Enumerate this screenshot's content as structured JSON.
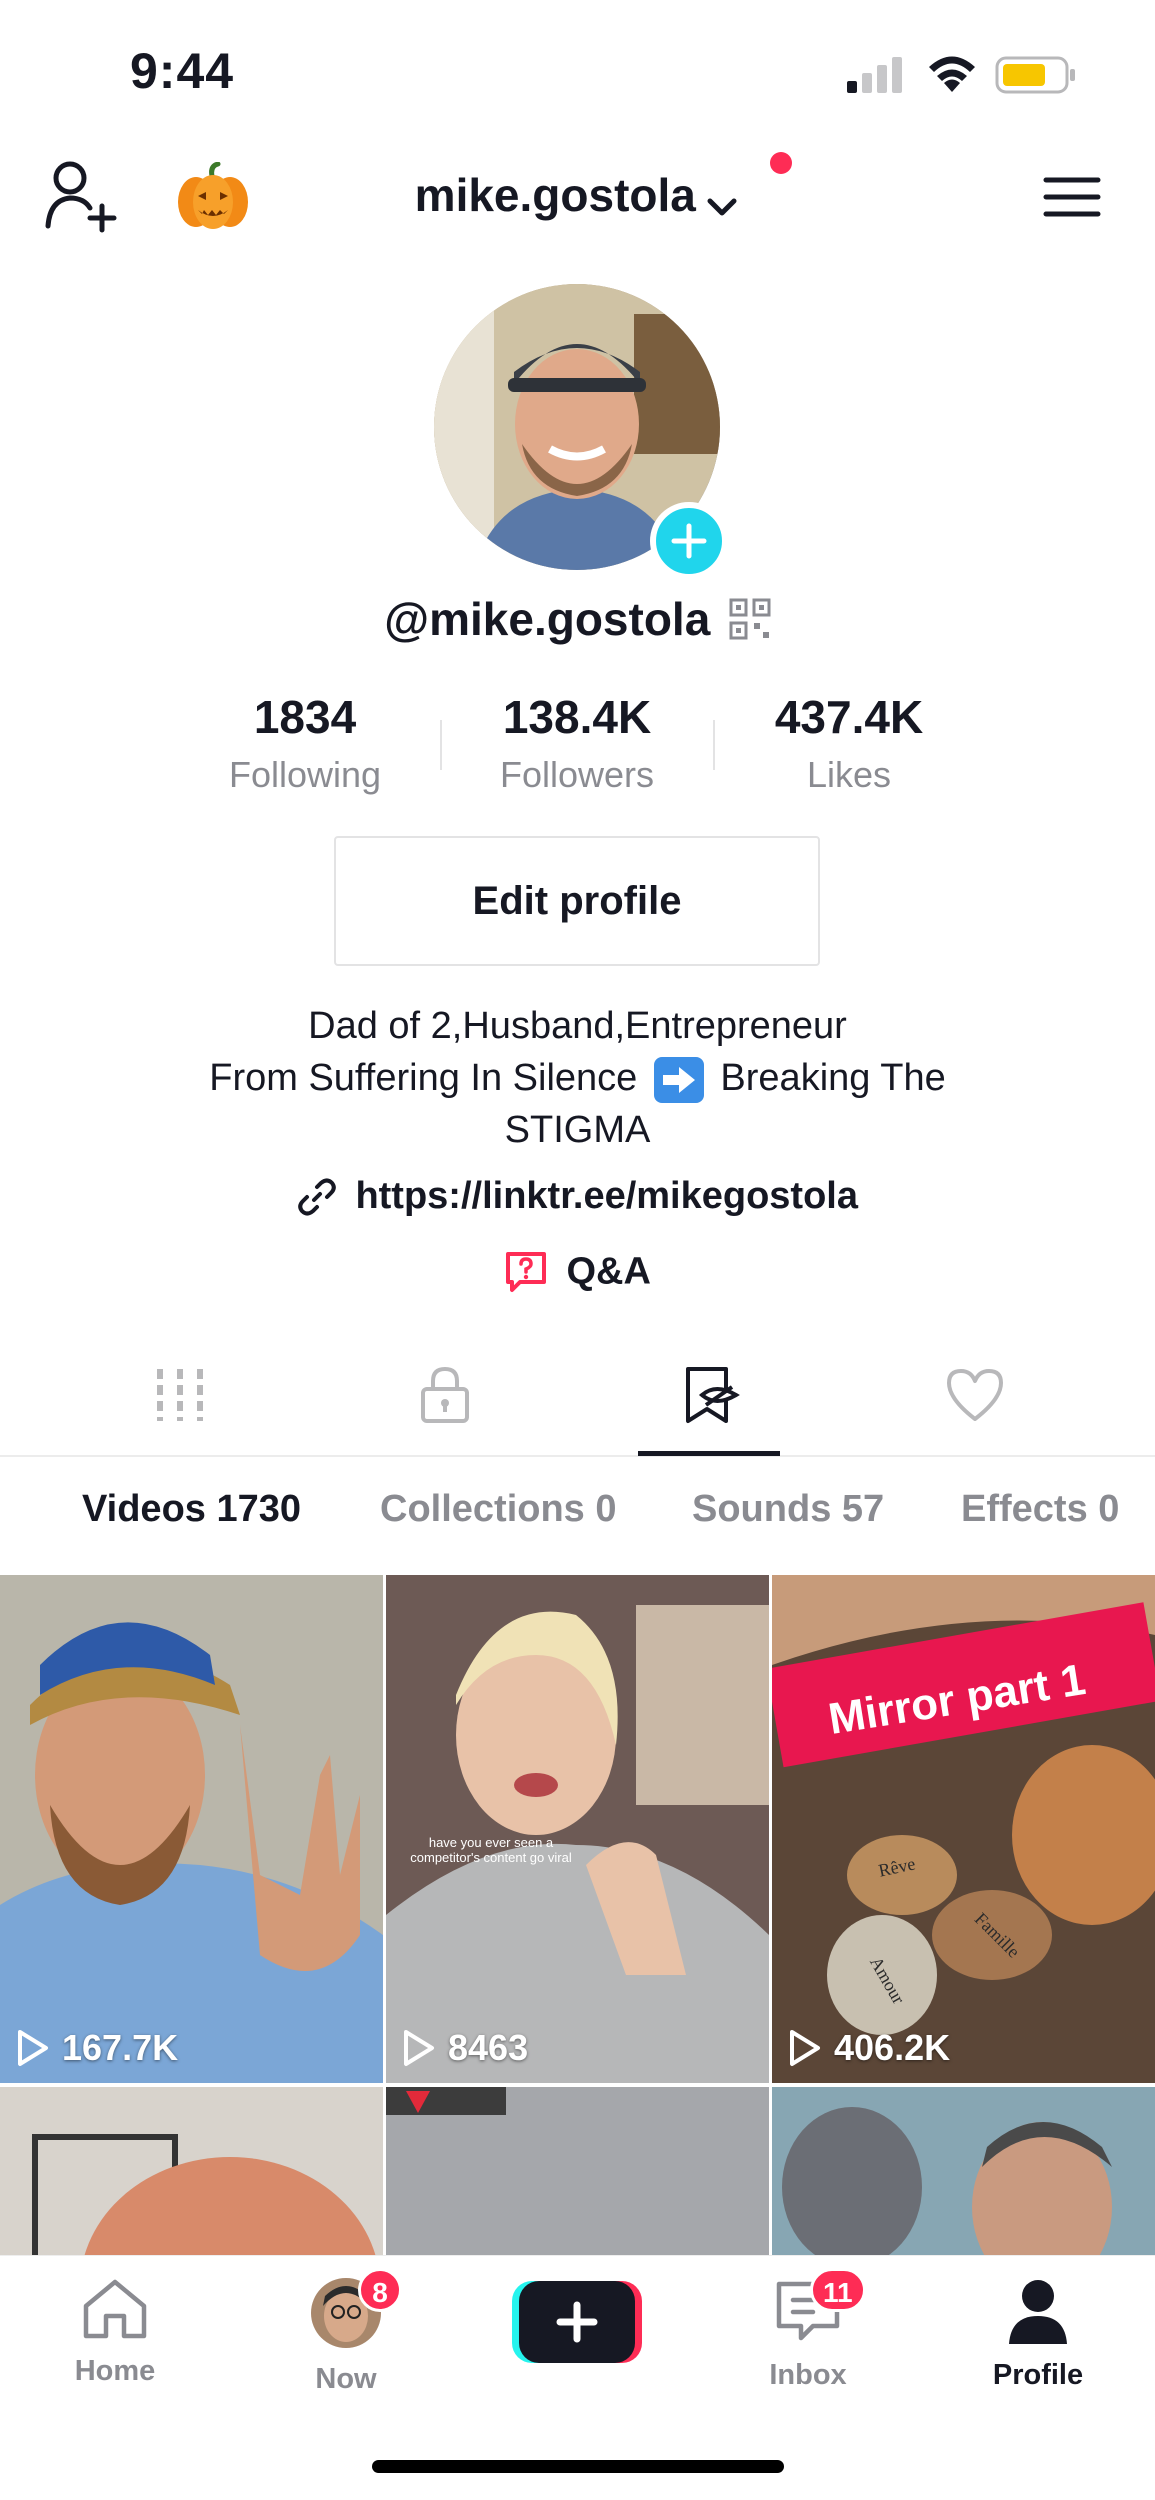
{
  "status_bar": {
    "time": "9:44"
  },
  "header": {
    "username": "mike.gostola"
  },
  "profile": {
    "handle": "@mike.gostola",
    "stats": [
      {
        "value": "1834",
        "label": "Following"
      },
      {
        "value": "138.4K",
        "label": "Followers"
      },
      {
        "value": "437.4K",
        "label": "Likes"
      }
    ],
    "edit_button": "Edit profile",
    "bio_line1": "Dad of 2,Husband,Entrepreneur",
    "bio_line2_a": "From Suffering In Silence",
    "bio_line2_b": "Breaking The",
    "bio_line3": "STIGMA",
    "link": "https://linktr.ee/mikegostola",
    "qa": "Q&A"
  },
  "subtabs": [
    {
      "label": "Videos 1730"
    },
    {
      "label": "Collections 0"
    },
    {
      "label": "Sounds 57"
    },
    {
      "label": "Effects 0"
    }
  ],
  "videos": [
    {
      "views": "167.7K"
    },
    {
      "views": "8463",
      "caption": "have you ever seen a competitor's content go viral"
    },
    {
      "views": "406.2K",
      "banner": "Mirror part 1",
      "stone_words": [
        "Rêve",
        "Famille",
        "Amour"
      ]
    }
  ],
  "bottom_nav": {
    "home": "Home",
    "now": "Now",
    "now_badge": "8",
    "inbox": "Inbox",
    "inbox_badge": "11",
    "profile": "Profile"
  },
  "colors": {
    "accent": "#fe2c55",
    "teal": "#20d5ec",
    "text": "#161823",
    "muted": "#8a8b91"
  }
}
